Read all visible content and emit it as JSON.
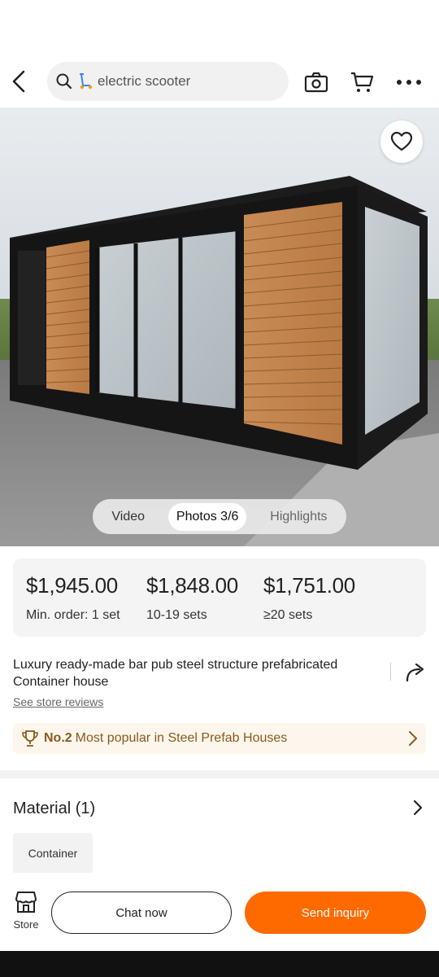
{
  "search": {
    "query": "electric scooter"
  },
  "media_tabs": [
    {
      "label": "Video"
    },
    {
      "label": "Photos 3/6"
    },
    {
      "label": "Highlights"
    }
  ],
  "price_tiers": [
    {
      "price": "$1,945.00",
      "qty": "Min. order: 1 set"
    },
    {
      "price": "$1,848.00",
      "qty": "10-19 sets"
    },
    {
      "price": "$1,751.00",
      "qty": "≥20 sets"
    }
  ],
  "product": {
    "title": " Luxury ready-made bar pub steel structure prefabricated Container house",
    "store_reviews": "See store reviews"
  },
  "ranking": {
    "number": "No.2",
    "text": "Most popular in Steel Prefab Houses"
  },
  "material": {
    "title": "Material (1)",
    "options": [
      "Container"
    ]
  },
  "bottom": {
    "store_label": "Store",
    "chat_label": "Chat now",
    "inquiry_label": "Send inquiry"
  },
  "colors": {
    "accent": "#ff6a00",
    "ranking_bg": "#fdf6ec",
    "ranking_text": "#8a5a1c"
  }
}
